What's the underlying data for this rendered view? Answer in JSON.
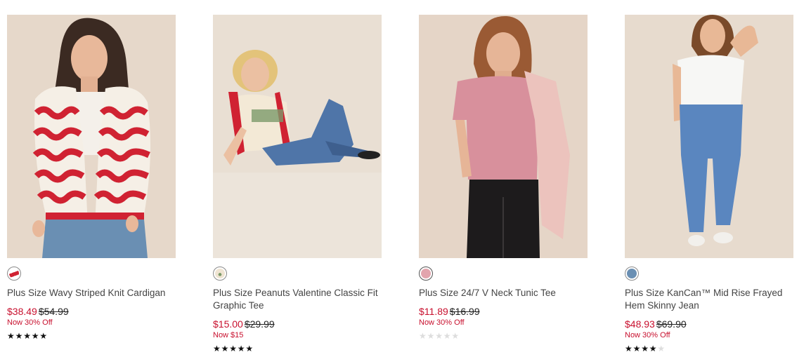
{
  "products": [
    {
      "title": "Plus Size Wavy Striped Knit Cardigan",
      "sale_price": "$38.49",
      "original_price": "$54.99",
      "promo": "Now 30% Off",
      "rating": 5,
      "swatch_color": "#d02232",
      "photo_bg": "#e6d8ca"
    },
    {
      "title": "Plus Size Peanuts Valentine Classic Fit Graphic Tee",
      "sale_price": "$15.00",
      "original_price": "$29.99",
      "promo": "Now $15",
      "rating": 5,
      "swatch_color": "#efe4d2",
      "photo_bg": "#e9dfd3"
    },
    {
      "title": "Plus Size 24/7 V Neck Tunic Tee",
      "sale_price": "$11.89",
      "original_price": "$16.99",
      "promo": "Now 30% Off",
      "rating": 0,
      "swatch_color": "#e2a4ad",
      "photo_bg": "#e5d5c7"
    },
    {
      "title": "Plus Size KanCan™ Mid Rise Frayed Hem Skinny Jean",
      "sale_price": "$48.93",
      "original_price": "$69.90",
      "promo": "Now 30% Off",
      "rating": 4,
      "swatch_color": "#6a8fb3",
      "photo_bg": "#e7dbce"
    }
  ]
}
